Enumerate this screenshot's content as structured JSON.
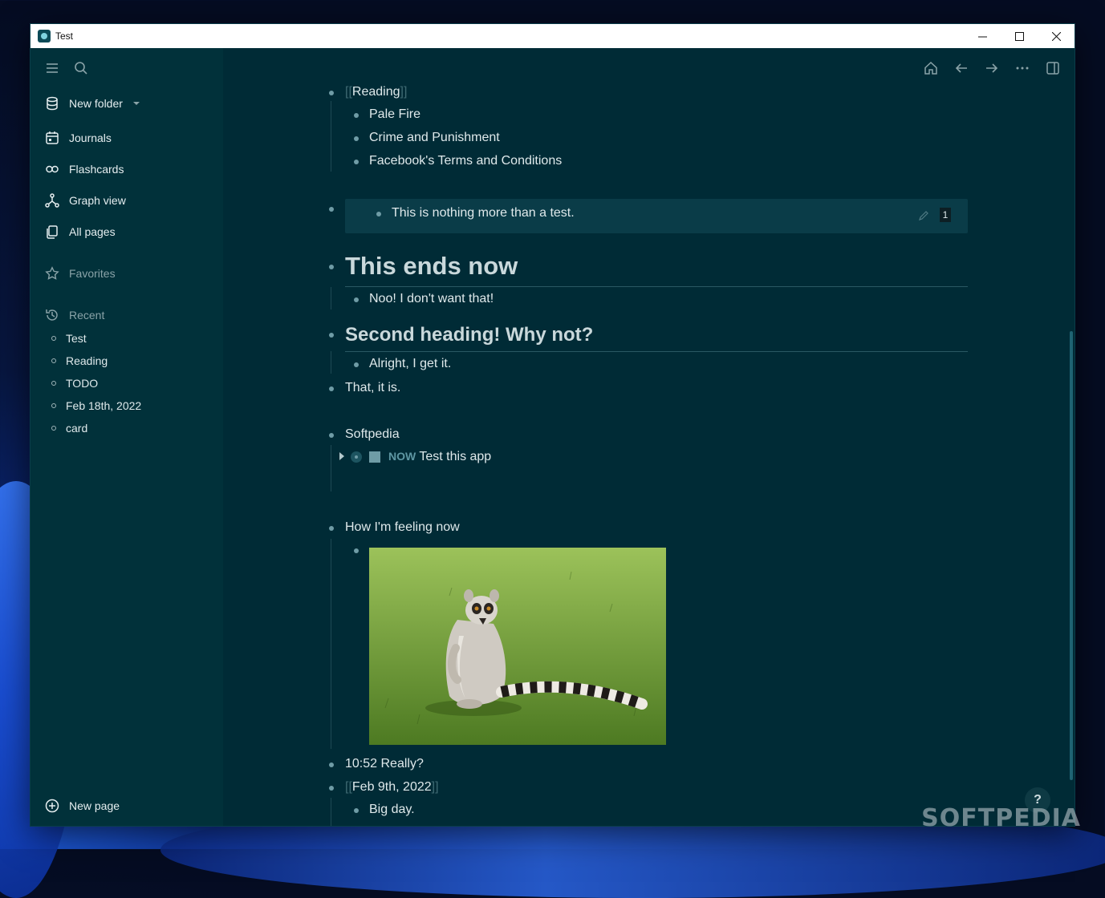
{
  "window": {
    "title": "Test"
  },
  "sidebar": {
    "folder_label": "New folder",
    "nav": [
      {
        "label": "Journals",
        "icon": "calendar-icon"
      },
      {
        "label": "Flashcards",
        "icon": "infinity-icon"
      },
      {
        "label": "Graph view",
        "icon": "graph-icon"
      },
      {
        "label": "All pages",
        "icon": "pages-icon"
      }
    ],
    "favorites_label": "Favorites",
    "recent_label": "Recent",
    "recent": [
      "Test",
      "Reading",
      "TODO",
      "Feb 18th, 2022",
      "card"
    ],
    "new_page_label": "New page"
  },
  "content": {
    "reading": {
      "open": "[[",
      "label": "Reading",
      "close": "]]"
    },
    "books": [
      "Pale Fire",
      "Crime and Punishment",
      "Facebook's Terms and Conditions"
    ],
    "quote": {
      "text": "This is nothing more than a test.",
      "count": "1"
    },
    "h1": "This ends now",
    "h1_child": "Noo! I don't want that!",
    "h2": "Second heading! Why not?",
    "h2_child": "Alright, I get it.",
    "that": "That, it is.",
    "softpedia": "Softpedia",
    "task": {
      "marker": "NOW",
      "text": "Test this app"
    },
    "feeling": "How I'm feeling now",
    "time_note": "10:52 Really?",
    "date_link": {
      "open": "[[",
      "label": "Feb 9th, 2022",
      "close": "]]"
    },
    "big_day": "Big day."
  },
  "help_label": "?",
  "watermark": "SOFTPEDIA"
}
